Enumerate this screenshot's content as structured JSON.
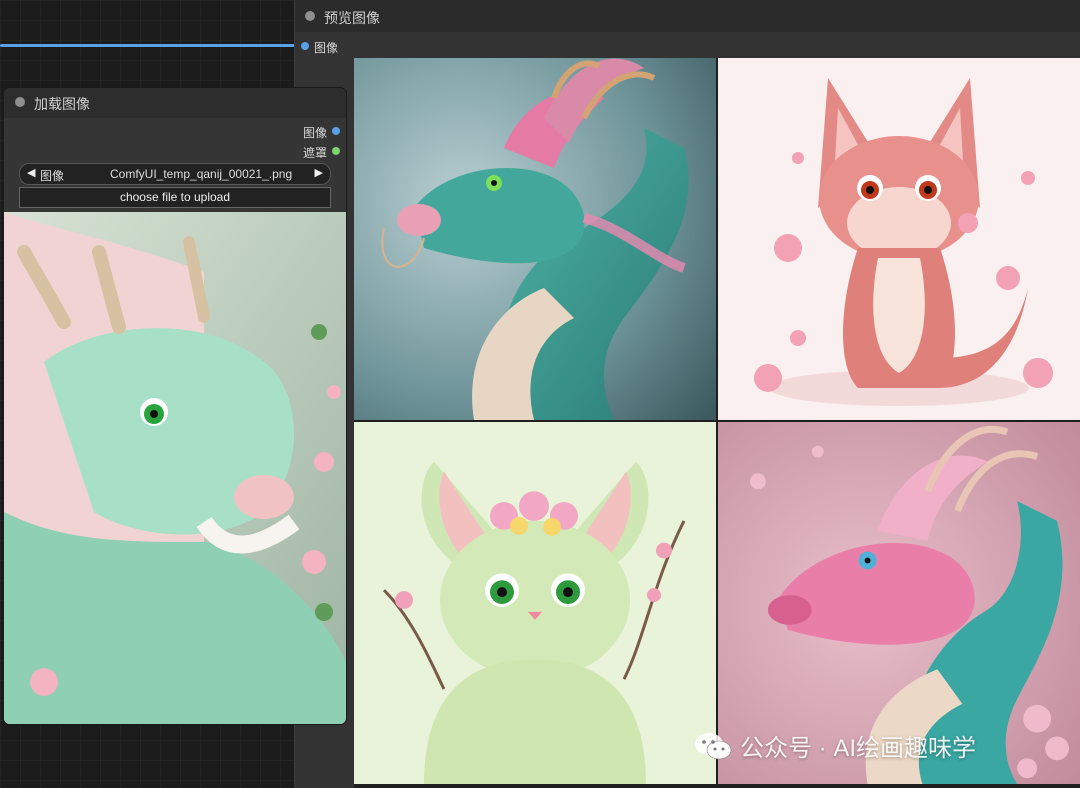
{
  "preview_node": {
    "title": "预览图像",
    "input_label": "图像"
  },
  "load_node": {
    "title": "加载图像",
    "outputs": [
      "图像",
      "遮罩"
    ],
    "image_widget": {
      "label": "图像",
      "value": "ComfyUI_temp_qanij_00021_.png"
    },
    "upload_button": "choose file to upload"
  },
  "watermark": {
    "text": "公众号 · AI绘画趣味学",
    "icon": "wechat-icon"
  },
  "colors": {
    "accent_link": "#5aa0e8",
    "mask_port": "#7ed36f",
    "image_port": "#5aa0e8",
    "node_bg": "#353535"
  }
}
